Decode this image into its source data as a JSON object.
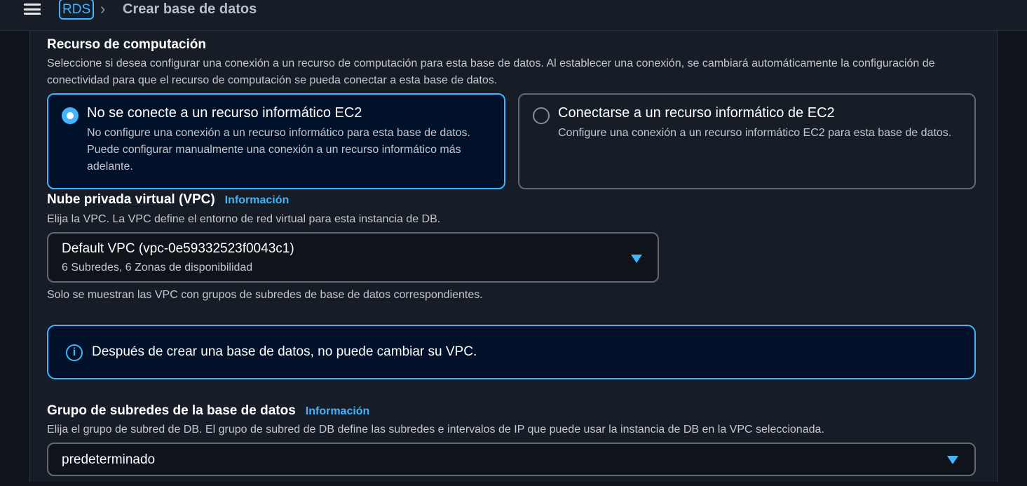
{
  "header": {
    "service_badge": "RDS",
    "breadcrumb_separator": "›",
    "breadcrumb_current": "Crear base de datos"
  },
  "compute": {
    "title": "Recurso de computación",
    "description": "Seleccione si desea configurar una conexión a un recurso de computación para esta base de datos. Al establecer una conexión, se cambiará automáticamente la configuración de conectividad para que el recurso de computación se pueda conectar a esta base de datos.",
    "options": [
      {
        "title": "No se conecte a un recurso informático EC2",
        "description": "No configure una conexión a un recurso informático para esta base de datos. Puede configurar manualmente una conexión a un recurso informático más adelante.",
        "selected": true
      },
      {
        "title": "Conectarse a un recurso informático de EC2",
        "description": "Configure una conexión a un recurso informático EC2 para esta base de datos.",
        "selected": false
      }
    ]
  },
  "vpc": {
    "title": "Nube privada virtual (VPC)",
    "info_label": "Información",
    "description": "Elija la VPC. La VPC define el entorno de red virtual para esta instancia de DB.",
    "selected_value": "Default VPC (vpc-0e59332523f0043c1)",
    "selected_sub": "6 Subredes, 6 Zonas de disponibilidad",
    "hint": "Solo se muestran las VPC con grupos de subredes de base de datos correspondientes."
  },
  "alert": {
    "icon": "info-icon",
    "text": "Después de crear una base de datos, no puede cambiar su VPC."
  },
  "subnet": {
    "title": "Grupo de subredes de la base de datos",
    "info_label": "Información",
    "description": "Elija el grupo de subred de DB. El grupo de subred de DB define las subredes e intervalos de IP que puede usar la instancia de DB en la VPC seleccionada.",
    "selected_value": "predeterminado"
  },
  "colors": {
    "accent": "#42b4ff",
    "background": "#161d26",
    "selected_tile_bg": "#001129"
  }
}
